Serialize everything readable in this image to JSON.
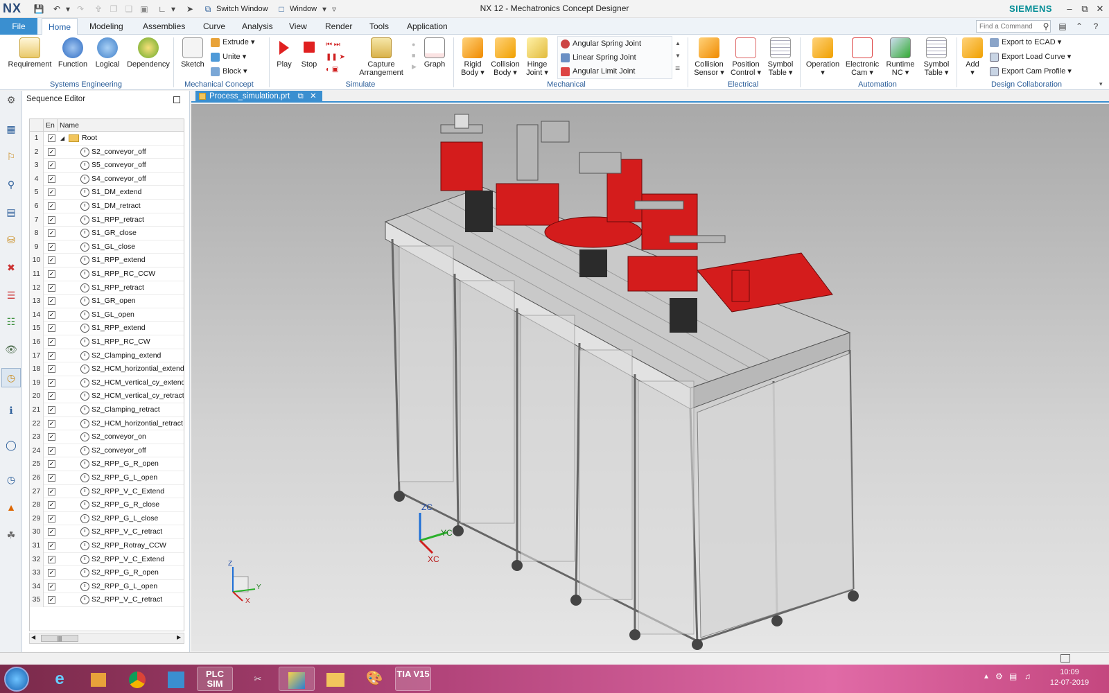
{
  "titlebar": {
    "logo": "NX",
    "switch_window": "Switch Window",
    "window": "Window",
    "title": "NX 12 - Mechatronics Concept Designer",
    "brand": "SIEMENS"
  },
  "menu": {
    "file": "File",
    "tabs": [
      "Home",
      "Modeling",
      "Assemblies",
      "Curve",
      "Analysis",
      "View",
      "Render",
      "Tools",
      "Application"
    ],
    "active_tab": "Home",
    "find_placeholder": "Find a Command"
  },
  "ribbon": {
    "systems_engineering": {
      "label": "Systems Engineering",
      "buttons": [
        "Requirement",
        "Function",
        "Logical",
        "Dependency"
      ]
    },
    "mechanical_concept": {
      "label": "Mechanical Concept",
      "sketch": "Sketch",
      "extrude": "Extrude",
      "unite": "Unite",
      "block": "Block"
    },
    "simulate": {
      "label": "Simulate",
      "play": "Play",
      "stop": "Stop",
      "capture": "Capture Arrangement",
      "graph": "Graph"
    },
    "mechanical": {
      "label": "Mechanical",
      "rigid": "Rigid Body",
      "collision": "Collision Body",
      "hinge": "Hinge Joint",
      "joints": [
        "Angular Spring Joint",
        "Linear Spring Joint",
        "Angular Limit Joint"
      ]
    },
    "electrical": {
      "label": "Electrical",
      "buttons": [
        "Collision Sensor",
        "Position Control",
        "Symbol Table"
      ]
    },
    "automation": {
      "label": "Automation",
      "buttons": [
        "Operation",
        "Electronic Cam",
        "Runtime NC",
        "Symbol Table"
      ]
    },
    "design_collab": {
      "label": "Design Collaboration",
      "add": "Add",
      "exports": [
        "Export to ECAD",
        "Export Load Curve",
        "Export Cam Profile"
      ]
    }
  },
  "sequence_editor": {
    "title": "Sequence Editor",
    "col_en": "En",
    "col_name": "Name",
    "root": "Root",
    "rows": [
      "S2_conveyor_off",
      "S5_conveyor_off",
      "S4_conveyor_off",
      "S1_DM_extend",
      "S1_DM_retract",
      "S1_RPP_retract",
      "S1_GR_close",
      "S1_GL_close",
      "S1_RPP_extend",
      "S1_RPP_RC_CCW",
      "S1_RPP_retract",
      "S1_GR_open",
      "S1_GL_open",
      "S1_RPP_extend",
      "S1_RPP_RC_CW",
      "S2_Clamping_extend",
      "S2_HCM_horizontial_extend",
      "S2_HCM_vertical_cy_extend",
      "S2_HCM_vertical_cy_retract",
      "S2_Clamping_retract",
      "S2_HCM_horizontial_retract",
      "S2_conveyor_on",
      "S2_conveyor_off",
      "S2_RPP_G_R_open",
      "S2_RPP_G_L_open",
      "S2_RPP_V_C_Extend",
      "S2_RPP_G_R_close",
      "S2_RPP_G_L_close",
      "S2_RPP_V_C_retract",
      "S2_RPP_Rotray_CCW",
      "S2_RPP_V_C_Extend",
      "S2_RPP_G_R_open",
      "S2_RPP_G_L_open",
      "S2_RPP_V_C_retract"
    ]
  },
  "document": {
    "tab": "Process_simulation.prt"
  },
  "viewport": {
    "axes": {
      "z": "ZC",
      "y": "YC",
      "x": "XC",
      "triad_z": "Z",
      "triad_y": "Y",
      "triad_x": "X"
    }
  },
  "taskbar": {
    "plc": "PLC SIM",
    "tia": "TIA V15",
    "time": "10:09",
    "date": "12-07-2019"
  }
}
